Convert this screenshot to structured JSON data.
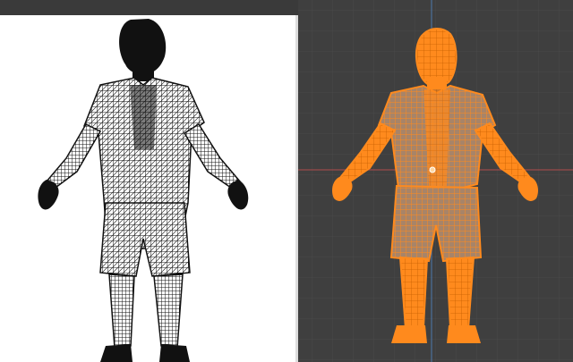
{
  "app": {
    "title": "",
    "viewports": [
      {
        "name": "uv-or-wireframe-preview",
        "mode": "wireframe"
      },
      {
        "name": "3d-viewport",
        "mode": "wireframe-selected"
      }
    ]
  },
  "colors": {
    "left_bg": "#ffffff",
    "left_frame": "#dcdcdc",
    "viewport_bg": "#3f3f3f",
    "grid_minor": "#4a4a4a",
    "grid_major": "#555555",
    "axis_x": "#9a4b4b",
    "axis_y": "#4b6f9a",
    "mesh_black": "#111111",
    "mesh_orange": "#ff8a1d",
    "mesh_orange_dark": "#e96d00"
  },
  "icons": {
    "selection_origin": "origin-dot-icon"
  }
}
